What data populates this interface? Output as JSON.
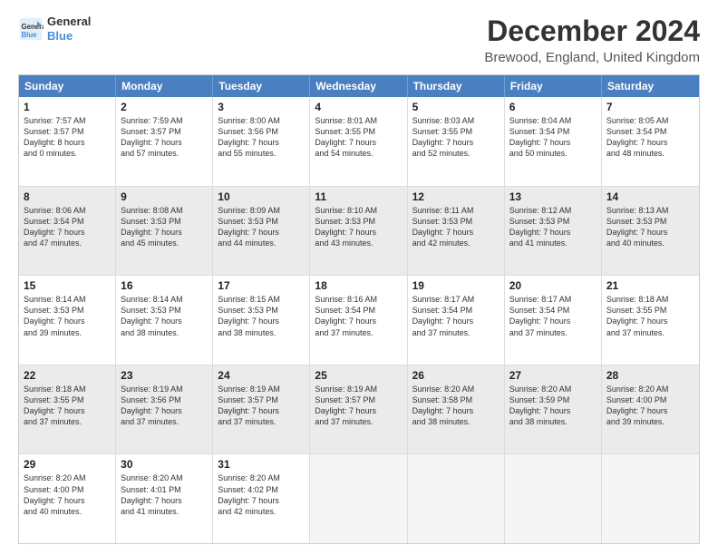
{
  "header": {
    "logo_line1": "General",
    "logo_line2": "Blue",
    "main_title": "December 2024",
    "subtitle": "Brewood, England, United Kingdom"
  },
  "calendar": {
    "days": [
      "Sunday",
      "Monday",
      "Tuesday",
      "Wednesday",
      "Thursday",
      "Friday",
      "Saturday"
    ],
    "rows": [
      [
        {
          "day": "1",
          "lines": [
            "Sunrise: 7:57 AM",
            "Sunset: 3:57 PM",
            "Daylight: 8 hours",
            "and 0 minutes."
          ],
          "shade": false
        },
        {
          "day": "2",
          "lines": [
            "Sunrise: 7:59 AM",
            "Sunset: 3:57 PM",
            "Daylight: 7 hours",
            "and 57 minutes."
          ],
          "shade": false
        },
        {
          "day": "3",
          "lines": [
            "Sunrise: 8:00 AM",
            "Sunset: 3:56 PM",
            "Daylight: 7 hours",
            "and 55 minutes."
          ],
          "shade": false
        },
        {
          "day": "4",
          "lines": [
            "Sunrise: 8:01 AM",
            "Sunset: 3:55 PM",
            "Daylight: 7 hours",
            "and 54 minutes."
          ],
          "shade": false
        },
        {
          "day": "5",
          "lines": [
            "Sunrise: 8:03 AM",
            "Sunset: 3:55 PM",
            "Daylight: 7 hours",
            "and 52 minutes."
          ],
          "shade": false
        },
        {
          "day": "6",
          "lines": [
            "Sunrise: 8:04 AM",
            "Sunset: 3:54 PM",
            "Daylight: 7 hours",
            "and 50 minutes."
          ],
          "shade": false
        },
        {
          "day": "7",
          "lines": [
            "Sunrise: 8:05 AM",
            "Sunset: 3:54 PM",
            "Daylight: 7 hours",
            "and 48 minutes."
          ],
          "shade": false
        }
      ],
      [
        {
          "day": "8",
          "lines": [
            "Sunrise: 8:06 AM",
            "Sunset: 3:54 PM",
            "Daylight: 7 hours",
            "and 47 minutes."
          ],
          "shade": true
        },
        {
          "day": "9",
          "lines": [
            "Sunrise: 8:08 AM",
            "Sunset: 3:53 PM",
            "Daylight: 7 hours",
            "and 45 minutes."
          ],
          "shade": true
        },
        {
          "day": "10",
          "lines": [
            "Sunrise: 8:09 AM",
            "Sunset: 3:53 PM",
            "Daylight: 7 hours",
            "and 44 minutes."
          ],
          "shade": true
        },
        {
          "day": "11",
          "lines": [
            "Sunrise: 8:10 AM",
            "Sunset: 3:53 PM",
            "Daylight: 7 hours",
            "and 43 minutes."
          ],
          "shade": true
        },
        {
          "day": "12",
          "lines": [
            "Sunrise: 8:11 AM",
            "Sunset: 3:53 PM",
            "Daylight: 7 hours",
            "and 42 minutes."
          ],
          "shade": true
        },
        {
          "day": "13",
          "lines": [
            "Sunrise: 8:12 AM",
            "Sunset: 3:53 PM",
            "Daylight: 7 hours",
            "and 41 minutes."
          ],
          "shade": true
        },
        {
          "day": "14",
          "lines": [
            "Sunrise: 8:13 AM",
            "Sunset: 3:53 PM",
            "Daylight: 7 hours",
            "and 40 minutes."
          ],
          "shade": true
        }
      ],
      [
        {
          "day": "15",
          "lines": [
            "Sunrise: 8:14 AM",
            "Sunset: 3:53 PM",
            "Daylight: 7 hours",
            "and 39 minutes."
          ],
          "shade": false
        },
        {
          "day": "16",
          "lines": [
            "Sunrise: 8:14 AM",
            "Sunset: 3:53 PM",
            "Daylight: 7 hours",
            "and 38 minutes."
          ],
          "shade": false
        },
        {
          "day": "17",
          "lines": [
            "Sunrise: 8:15 AM",
            "Sunset: 3:53 PM",
            "Daylight: 7 hours",
            "and 38 minutes."
          ],
          "shade": false
        },
        {
          "day": "18",
          "lines": [
            "Sunrise: 8:16 AM",
            "Sunset: 3:54 PM",
            "Daylight: 7 hours",
            "and 37 minutes."
          ],
          "shade": false
        },
        {
          "day": "19",
          "lines": [
            "Sunrise: 8:17 AM",
            "Sunset: 3:54 PM",
            "Daylight: 7 hours",
            "and 37 minutes."
          ],
          "shade": false
        },
        {
          "day": "20",
          "lines": [
            "Sunrise: 8:17 AM",
            "Sunset: 3:54 PM",
            "Daylight: 7 hours",
            "and 37 minutes."
          ],
          "shade": false
        },
        {
          "day": "21",
          "lines": [
            "Sunrise: 8:18 AM",
            "Sunset: 3:55 PM",
            "Daylight: 7 hours",
            "and 37 minutes."
          ],
          "shade": false
        }
      ],
      [
        {
          "day": "22",
          "lines": [
            "Sunrise: 8:18 AM",
            "Sunset: 3:55 PM",
            "Daylight: 7 hours",
            "and 37 minutes."
          ],
          "shade": true
        },
        {
          "day": "23",
          "lines": [
            "Sunrise: 8:19 AM",
            "Sunset: 3:56 PM",
            "Daylight: 7 hours",
            "and 37 minutes."
          ],
          "shade": true
        },
        {
          "day": "24",
          "lines": [
            "Sunrise: 8:19 AM",
            "Sunset: 3:57 PM",
            "Daylight: 7 hours",
            "and 37 minutes."
          ],
          "shade": true
        },
        {
          "day": "25",
          "lines": [
            "Sunrise: 8:19 AM",
            "Sunset: 3:57 PM",
            "Daylight: 7 hours",
            "and 37 minutes."
          ],
          "shade": true
        },
        {
          "day": "26",
          "lines": [
            "Sunrise: 8:20 AM",
            "Sunset: 3:58 PM",
            "Daylight: 7 hours",
            "and 38 minutes."
          ],
          "shade": true
        },
        {
          "day": "27",
          "lines": [
            "Sunrise: 8:20 AM",
            "Sunset: 3:59 PM",
            "Daylight: 7 hours",
            "and 38 minutes."
          ],
          "shade": true
        },
        {
          "day": "28",
          "lines": [
            "Sunrise: 8:20 AM",
            "Sunset: 4:00 PM",
            "Daylight: 7 hours",
            "and 39 minutes."
          ],
          "shade": true
        }
      ],
      [
        {
          "day": "29",
          "lines": [
            "Sunrise: 8:20 AM",
            "Sunset: 4:00 PM",
            "Daylight: 7 hours",
            "and 40 minutes."
          ],
          "shade": false
        },
        {
          "day": "30",
          "lines": [
            "Sunrise: 8:20 AM",
            "Sunset: 4:01 PM",
            "Daylight: 7 hours",
            "and 41 minutes."
          ],
          "shade": false
        },
        {
          "day": "31",
          "lines": [
            "Sunrise: 8:20 AM",
            "Sunset: 4:02 PM",
            "Daylight: 7 hours",
            "and 42 minutes."
          ],
          "shade": false
        },
        {
          "day": "",
          "lines": [],
          "shade": false,
          "empty": true
        },
        {
          "day": "",
          "lines": [],
          "shade": false,
          "empty": true
        },
        {
          "day": "",
          "lines": [],
          "shade": false,
          "empty": true
        },
        {
          "day": "",
          "lines": [],
          "shade": false,
          "empty": true
        }
      ]
    ]
  }
}
